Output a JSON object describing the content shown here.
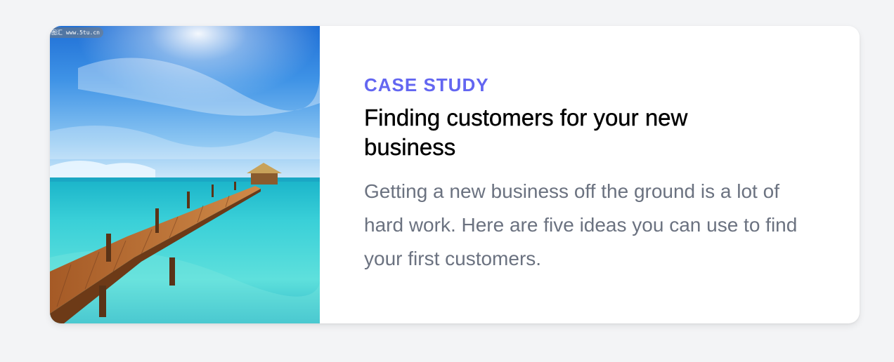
{
  "card": {
    "image": {
      "alt": "Wooden pier over turquoise sea",
      "watermark_text": "图汇 www.5tu.cn"
    },
    "eyebrow": "CASE STUDY",
    "title": "Finding customers for your new business",
    "description": "Getting a new business off the ground is a lot of hard work. Here are five ideas you can use to find your first customers."
  },
  "colors": {
    "page_background": "#f3f4f6",
    "card_background": "#ffffff",
    "eyebrow": "#6366f1",
    "title": "#000000",
    "description": "#6b7280"
  }
}
